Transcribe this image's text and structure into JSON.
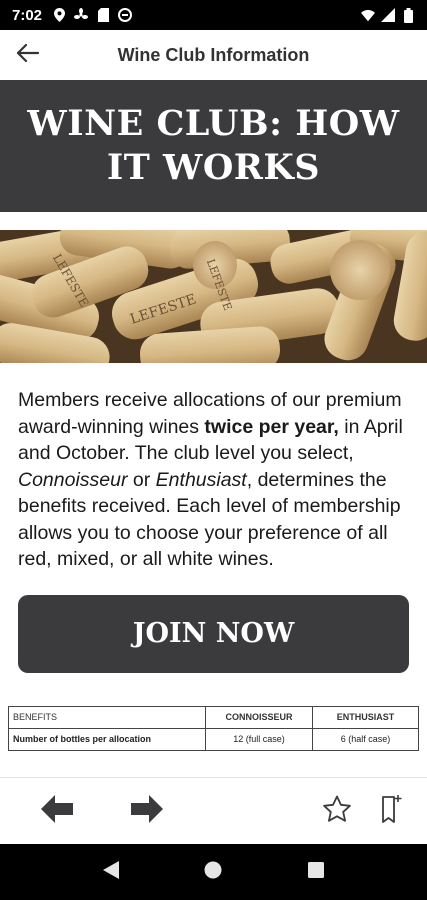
{
  "status_bar": {
    "time": "7:02",
    "left_icons": [
      "location-icon",
      "fan-icon",
      "sd-card-icon",
      "no-disturb-icon"
    ],
    "right_icons": [
      "wifi-icon",
      "signal-icon",
      "battery-icon"
    ]
  },
  "app_bar": {
    "back_icon": "arrow-back-icon",
    "title": "Wine Club Information"
  },
  "banner": {
    "title": "WINE CLUB: HOW IT WORKS"
  },
  "image": {
    "cork_text_1": "LEFESTE",
    "cork_text_2": "LEFESTE",
    "cork_text_3": "LEFESTE"
  },
  "intro": {
    "part1": "Members receive allocations of our premium award-winning wines ",
    "bold": "twice per year,",
    "part2": " in April and October. The club level you select, ",
    "italic1": "Connoisseur",
    "part3": " or ",
    "italic2": "Enthusiast",
    "part4": ", determines the benefits received. Each level of membership allows you to choose your preference of all red, mixed, or all white wines."
  },
  "join_button": {
    "label": "JOIN NOW"
  },
  "benefits_table": {
    "headers": [
      "BENEFITS",
      "CONNOISSEUR",
      "ENTHUSIAST"
    ],
    "rows": [
      {
        "label": "Number of bottles per allocation",
        "connoisseur": "12 (full case)",
        "enthusiast": "6 (half case)"
      }
    ]
  },
  "toolbar": {
    "back_icon": "arrow-left-icon",
    "forward_icon": "arrow-right-icon",
    "star_icon": "star-icon",
    "bookmark_icon": "bookmark-add-icon"
  },
  "nav_bar": {
    "icons": [
      "nav-back-icon",
      "nav-home-icon",
      "nav-recents-icon"
    ]
  },
  "colors": {
    "banner_bg": "#3b3a3c",
    "text": "#1a1a1a",
    "toolbar_icon": "#3b3a3c"
  }
}
